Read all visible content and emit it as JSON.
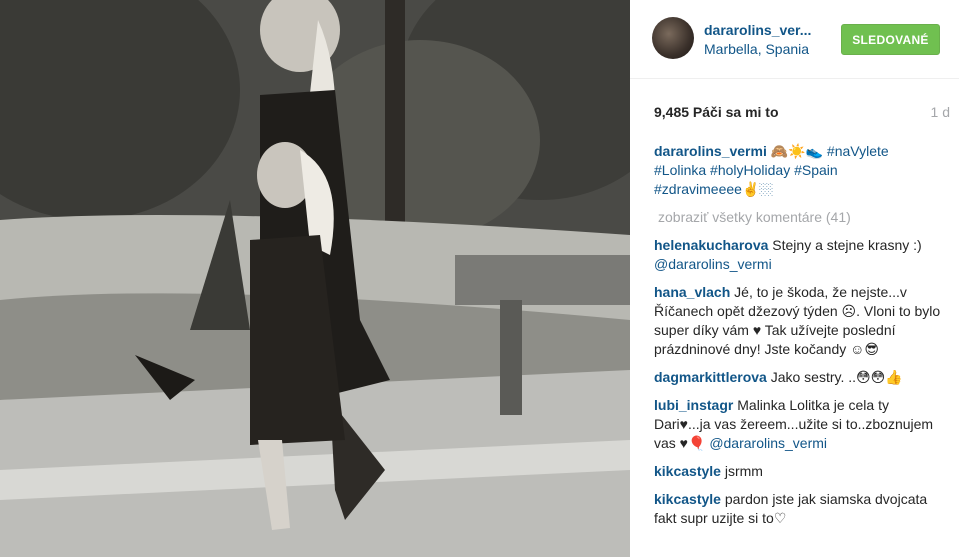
{
  "post": {
    "username": "dararolins_ver...",
    "location": "Marbella, Spania",
    "follow_label": "SLEDOVANÉ",
    "likes": "9,485 Páči sa mi to",
    "time": "1 d"
  },
  "caption": {
    "author": "dararolins_vermi",
    "emoji": "🙈☀️👟",
    "tags": [
      "#naVylete",
      "#Lolinka",
      "#holyHoliday",
      "#Spain",
      "#zdravimeeee✌️🏼"
    ]
  },
  "view_all": "zobraziť všetky komentáre (41)",
  "comments": [
    {
      "author": "helenakucharova",
      "text": "Stejny a stejne krasny :)",
      "mention": "@dararolins_vermi",
      "after": ""
    },
    {
      "author": "hana_vlach",
      "text": "Jé, to je škoda, že nejste...v Říčanech opět džezový týden ☹. Vloni to bylo super díky vám ♥ Tak užívejte poslední prázdninové dny! Jste kočandy ☺😎",
      "mention": "",
      "after": ""
    },
    {
      "author": "dagmarkittlerova",
      "text": "Jako sestry. ..😳😳👍",
      "mention": "",
      "after": ""
    },
    {
      "author": "lubi_instagr",
      "text": "Malinka Lolitka je cela ty Dari♥...ja vas žereem...užite si to..zboznujem vas ♥🎈",
      "mention": "@dararolins_vermi",
      "after": ""
    },
    {
      "author": "kikcastyle",
      "text": "jsrmm",
      "mention": "",
      "after": ""
    },
    {
      "author": "kikcastyle",
      "text": "pardon jste jak siamska dvojcata fakt supr uzijte si to♡",
      "mention": "",
      "after": ""
    }
  ]
}
